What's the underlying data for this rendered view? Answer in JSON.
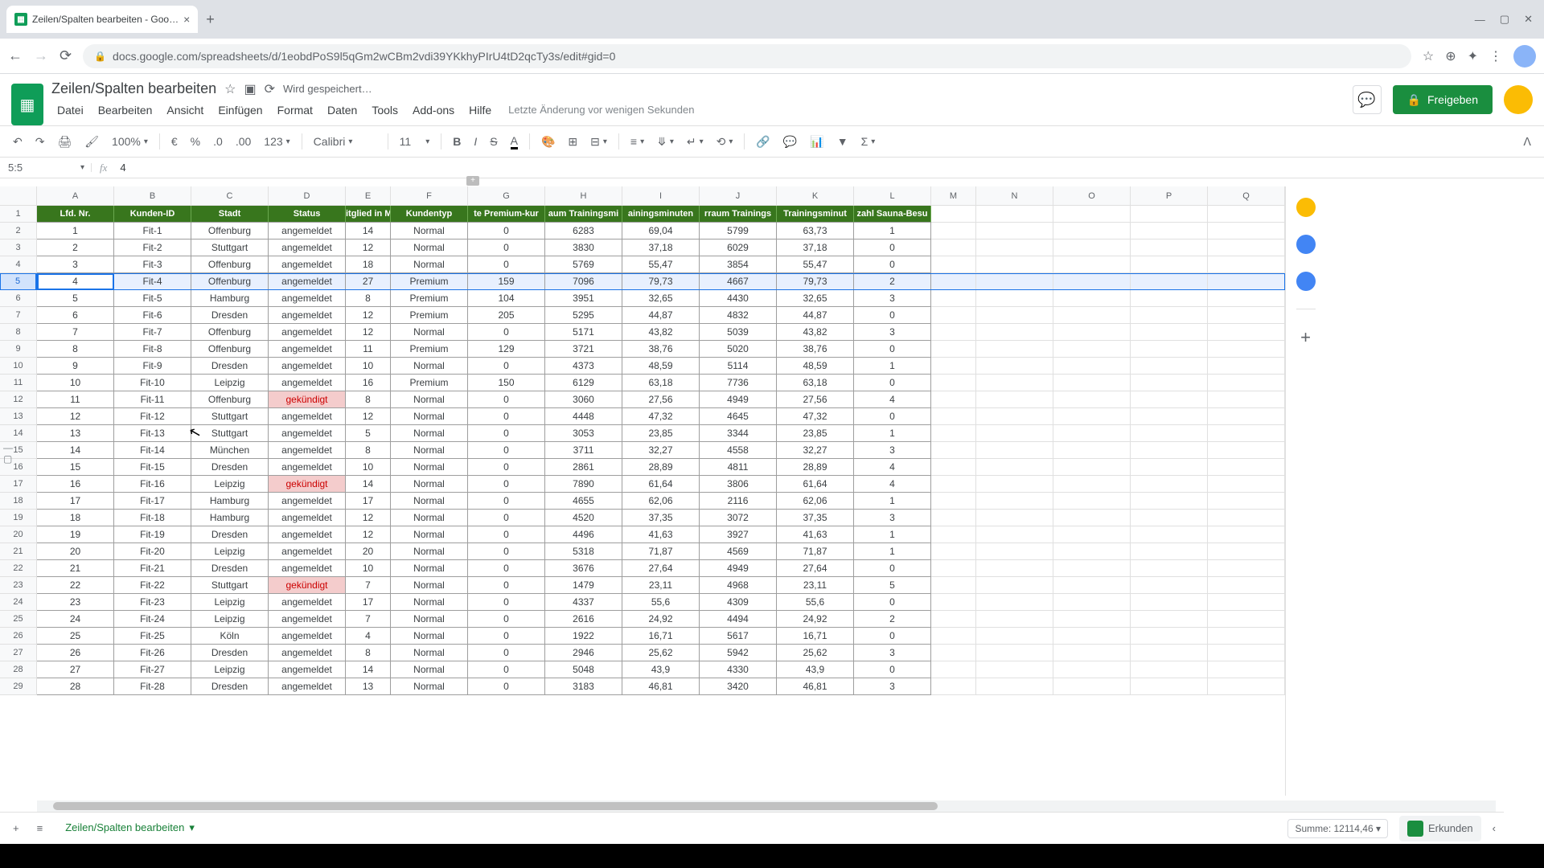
{
  "browser": {
    "tab_title": "Zeilen/Spalten bearbeiten - Goo…",
    "url": "docs.google.com/spreadsheets/d/1eobdPoS9l5qGm2wCBm2vdi39YKkhyPIrU4tD2qcTy3s/edit#gid=0"
  },
  "app": {
    "doc_title": "Zeilen/Spalten bearbeiten",
    "save_status": "Wird gespeichert…",
    "last_edit": "Letzte Änderung vor wenigen Sekunden",
    "menus": [
      "Datei",
      "Bearbeiten",
      "Ansicht",
      "Einfügen",
      "Format",
      "Daten",
      "Tools",
      "Add-ons",
      "Hilfe"
    ],
    "share_label": "Freigeben"
  },
  "toolbar": {
    "zoom": "100%",
    "currency": "€",
    "percent": "%",
    "dec_dec": ".0",
    "inc_dec": ".00",
    "format_more": "123",
    "font": "Calibri",
    "font_size": "11"
  },
  "namebox": {
    "ref": "5:5",
    "fx_value": "4"
  },
  "columns": [
    "A",
    "B",
    "C",
    "D",
    "E",
    "F",
    "G",
    "H",
    "I",
    "J",
    "K",
    "L",
    "M",
    "N",
    "O",
    "P",
    "Q"
  ],
  "headers": [
    "Lfd. Nr.",
    "Kunden-ID",
    "Stadt",
    "Status",
    "itglied in Monat",
    "Kundentyp",
    "te Premium-kur",
    "aum Trainingsmi",
    "ainingsminuten",
    "rraum Trainings",
    "Trainingsminut",
    "zahl Sauna-Besu"
  ],
  "selected_row_index": 3,
  "rows": [
    {
      "n": 1,
      "id": "Fit-1",
      "stadt": "Offenburg",
      "status": "angemeldet",
      "mon": "14",
      "typ": "Normal",
      "g": "0",
      "h": "6283",
      "i": "69,04",
      "j": "5799",
      "k": "63,73",
      "l": "1"
    },
    {
      "n": 2,
      "id": "Fit-2",
      "stadt": "Stuttgart",
      "status": "angemeldet",
      "mon": "12",
      "typ": "Normal",
      "g": "0",
      "h": "3830",
      "i": "37,18",
      "j": "6029",
      "k": "37,18",
      "l": "0"
    },
    {
      "n": 3,
      "id": "Fit-3",
      "stadt": "Offenburg",
      "status": "angemeldet",
      "mon": "18",
      "typ": "Normal",
      "g": "0",
      "h": "5769",
      "i": "55,47",
      "j": "3854",
      "k": "55,47",
      "l": "0"
    },
    {
      "n": 4,
      "id": "Fit-4",
      "stadt": "Offenburg",
      "status": "angemeldet",
      "mon": "27",
      "typ": "Premium",
      "g": "159",
      "h": "7096",
      "i": "79,73",
      "j": "4667",
      "k": "79,73",
      "l": "2"
    },
    {
      "n": 5,
      "id": "Fit-5",
      "stadt": "Hamburg",
      "status": "angemeldet",
      "mon": "8",
      "typ": "Premium",
      "g": "104",
      "h": "3951",
      "i": "32,65",
      "j": "4430",
      "k": "32,65",
      "l": "3"
    },
    {
      "n": 6,
      "id": "Fit-6",
      "stadt": "Dresden",
      "status": "angemeldet",
      "mon": "12",
      "typ": "Premium",
      "g": "205",
      "h": "5295",
      "i": "44,87",
      "j": "4832",
      "k": "44,87",
      "l": "0"
    },
    {
      "n": 7,
      "id": "Fit-7",
      "stadt": "Offenburg",
      "status": "angemeldet",
      "mon": "12",
      "typ": "Normal",
      "g": "0",
      "h": "5171",
      "i": "43,82",
      "j": "5039",
      "k": "43,82",
      "l": "3"
    },
    {
      "n": 8,
      "id": "Fit-8",
      "stadt": "Offenburg",
      "status": "angemeldet",
      "mon": "11",
      "typ": "Premium",
      "g": "129",
      "h": "3721",
      "i": "38,76",
      "j": "5020",
      "k": "38,76",
      "l": "0"
    },
    {
      "n": 9,
      "id": "Fit-9",
      "stadt": "Dresden",
      "status": "angemeldet",
      "mon": "10",
      "typ": "Normal",
      "g": "0",
      "h": "4373",
      "i": "48,59",
      "j": "5114",
      "k": "48,59",
      "l": "1"
    },
    {
      "n": 10,
      "id": "Fit-10",
      "stadt": "Leipzig",
      "status": "angemeldet",
      "mon": "16",
      "typ": "Premium",
      "g": "150",
      "h": "6129",
      "i": "63,18",
      "j": "7736",
      "k": "63,18",
      "l": "0"
    },
    {
      "n": 11,
      "id": "Fit-11",
      "stadt": "Offenburg",
      "status": "gekündigt",
      "mon": "8",
      "typ": "Normal",
      "g": "0",
      "h": "3060",
      "i": "27,56",
      "j": "4949",
      "k": "27,56",
      "l": "4",
      "warn": true
    },
    {
      "n": 12,
      "id": "Fit-12",
      "stadt": "Stuttgart",
      "status": "angemeldet",
      "mon": "12",
      "typ": "Normal",
      "g": "0",
      "h": "4448",
      "i": "47,32",
      "j": "4645",
      "k": "47,32",
      "l": "0"
    },
    {
      "n": 13,
      "id": "Fit-13",
      "stadt": "Stuttgart",
      "status": "angemeldet",
      "mon": "5",
      "typ": "Normal",
      "g": "0",
      "h": "3053",
      "i": "23,85",
      "j": "3344",
      "k": "23,85",
      "l": "1"
    },
    {
      "n": 14,
      "id": "Fit-14",
      "stadt": "München",
      "status": "angemeldet",
      "mon": "8",
      "typ": "Normal",
      "g": "0",
      "h": "3711",
      "i": "32,27",
      "j": "4558",
      "k": "32,27",
      "l": "3"
    },
    {
      "n": 15,
      "id": "Fit-15",
      "stadt": "Dresden",
      "status": "angemeldet",
      "mon": "10",
      "typ": "Normal",
      "g": "0",
      "h": "2861",
      "i": "28,89",
      "j": "4811",
      "k": "28,89",
      "l": "4"
    },
    {
      "n": 16,
      "id": "Fit-16",
      "stadt": "Leipzig",
      "status": "gekündigt",
      "mon": "14",
      "typ": "Normal",
      "g": "0",
      "h": "7890",
      "i": "61,64",
      "j": "3806",
      "k": "61,64",
      "l": "4",
      "warn": true
    },
    {
      "n": 17,
      "id": "Fit-17",
      "stadt": "Hamburg",
      "status": "angemeldet",
      "mon": "17",
      "typ": "Normal",
      "g": "0",
      "h": "4655",
      "i": "62,06",
      "j": "2116",
      "k": "62,06",
      "l": "1"
    },
    {
      "n": 18,
      "id": "Fit-18",
      "stadt": "Hamburg",
      "status": "angemeldet",
      "mon": "12",
      "typ": "Normal",
      "g": "0",
      "h": "4520",
      "i": "37,35",
      "j": "3072",
      "k": "37,35",
      "l": "3"
    },
    {
      "n": 19,
      "id": "Fit-19",
      "stadt": "Dresden",
      "status": "angemeldet",
      "mon": "12",
      "typ": "Normal",
      "g": "0",
      "h": "4496",
      "i": "41,63",
      "j": "3927",
      "k": "41,63",
      "l": "1"
    },
    {
      "n": 20,
      "id": "Fit-20",
      "stadt": "Leipzig",
      "status": "angemeldet",
      "mon": "20",
      "typ": "Normal",
      "g": "0",
      "h": "5318",
      "i": "71,87",
      "j": "4569",
      "k": "71,87",
      "l": "1"
    },
    {
      "n": 21,
      "id": "Fit-21",
      "stadt": "Dresden",
      "status": "angemeldet",
      "mon": "10",
      "typ": "Normal",
      "g": "0",
      "h": "3676",
      "i": "27,64",
      "j": "4949",
      "k": "27,64",
      "l": "0"
    },
    {
      "n": 22,
      "id": "Fit-22",
      "stadt": "Stuttgart",
      "status": "gekündigt",
      "mon": "7",
      "typ": "Normal",
      "g": "0",
      "h": "1479",
      "i": "23,11",
      "j": "4968",
      "k": "23,11",
      "l": "5",
      "warn": true
    },
    {
      "n": 23,
      "id": "Fit-23",
      "stadt": "Leipzig",
      "status": "angemeldet",
      "mon": "17",
      "typ": "Normal",
      "g": "0",
      "h": "4337",
      "i": "55,6",
      "j": "4309",
      "k": "55,6",
      "l": "0"
    },
    {
      "n": 24,
      "id": "Fit-24",
      "stadt": "Leipzig",
      "status": "angemeldet",
      "mon": "7",
      "typ": "Normal",
      "g": "0",
      "h": "2616",
      "i": "24,92",
      "j": "4494",
      "k": "24,92",
      "l": "2"
    },
    {
      "n": 25,
      "id": "Fit-25",
      "stadt": "Köln",
      "status": "angemeldet",
      "mon": "4",
      "typ": "Normal",
      "g": "0",
      "h": "1922",
      "i": "16,71",
      "j": "5617",
      "k": "16,71",
      "l": "0"
    },
    {
      "n": 26,
      "id": "Fit-26",
      "stadt": "Dresden",
      "status": "angemeldet",
      "mon": "8",
      "typ": "Normal",
      "g": "0",
      "h": "2946",
      "i": "25,62",
      "j": "5942",
      "k": "25,62",
      "l": "3"
    },
    {
      "n": 27,
      "id": "Fit-27",
      "stadt": "Leipzig",
      "status": "angemeldet",
      "mon": "14",
      "typ": "Normal",
      "g": "0",
      "h": "5048",
      "i": "43,9",
      "j": "4330",
      "k": "43,9",
      "l": "0"
    },
    {
      "n": 28,
      "id": "Fit-28",
      "stadt": "Dresden",
      "status": "angemeldet",
      "mon": "13",
      "typ": "Normal",
      "g": "0",
      "h": "3183",
      "i": "46,81",
      "j": "3420",
      "k": "46,81",
      "l": "3"
    }
  ],
  "footer": {
    "sheet_name": "Zeilen/Spalten bearbeiten",
    "sum_label": "Summe: 12114,46",
    "explore_label": "Erkunden"
  }
}
